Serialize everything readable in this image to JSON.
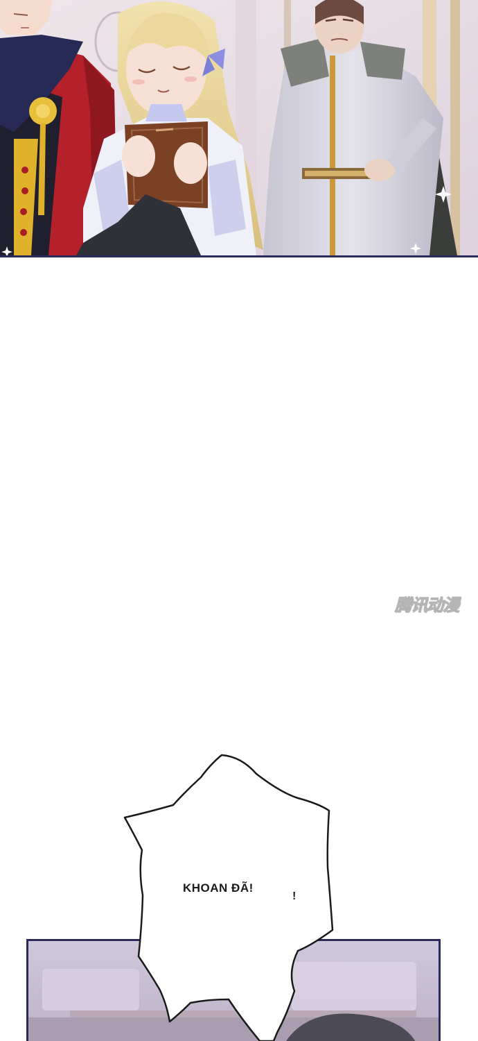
{
  "comic": {
    "speech_bubble_text": "KHOAN ĐÃ!",
    "speech_bubble_mark": "!",
    "watermark_text": "腾讯动漫"
  },
  "colors": {
    "panel_border": "#2c2a5a",
    "red_uniform": "#b5212b",
    "navy_scarf": "#262a55",
    "gold_accent": "#e0b22c",
    "blonde_hair": "#e9d49a",
    "book_brown": "#7a4124",
    "gray_robe": "#d5d3de",
    "background_pink": "#e9dfe7"
  }
}
